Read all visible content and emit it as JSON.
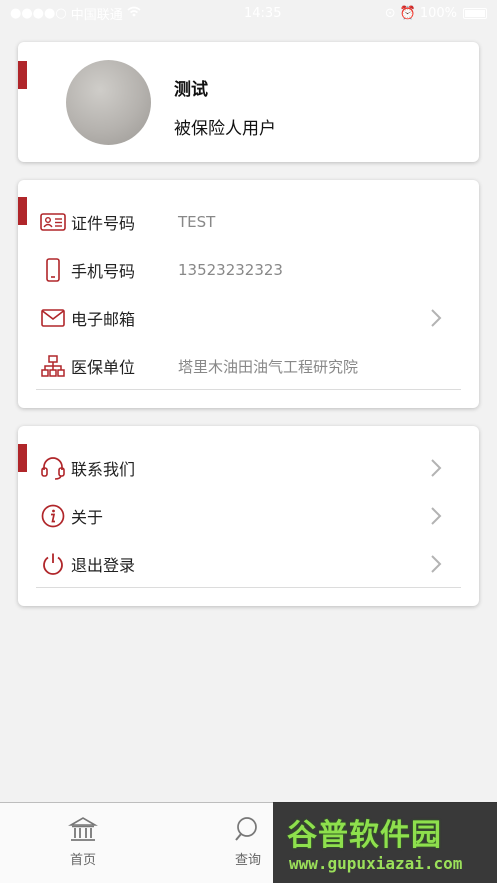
{
  "status_bar": {
    "carrier": "中国联通",
    "time": "14:35",
    "battery": "100%"
  },
  "profile": {
    "name": "测试",
    "role": "被保险人用户"
  },
  "info": {
    "rows": [
      {
        "label": "证件号码",
        "value": "TEST",
        "icon": "id-card-icon"
      },
      {
        "label": "手机号码",
        "value": "13523232323",
        "icon": "phone-icon"
      },
      {
        "label": "电子邮箱",
        "value": "",
        "icon": "mail-icon"
      },
      {
        "label": "医保单位",
        "value": "塔里木油田油气工程研究院",
        "icon": "org-chart-icon"
      }
    ]
  },
  "menu": {
    "items": [
      {
        "label": "联系我们",
        "icon": "headset-icon"
      },
      {
        "label": "关于",
        "icon": "info-icon"
      },
      {
        "label": "退出登录",
        "icon": "power-icon"
      }
    ]
  },
  "tabs": {
    "home": "首页",
    "query": "查询"
  },
  "watermark": {
    "logo_text": "谷普软件园",
    "url": "www.gupuxiazai.com"
  },
  "colors": {
    "accent": "#b0262a",
    "background": "#f2f2f2",
    "value_text": "#888888"
  }
}
